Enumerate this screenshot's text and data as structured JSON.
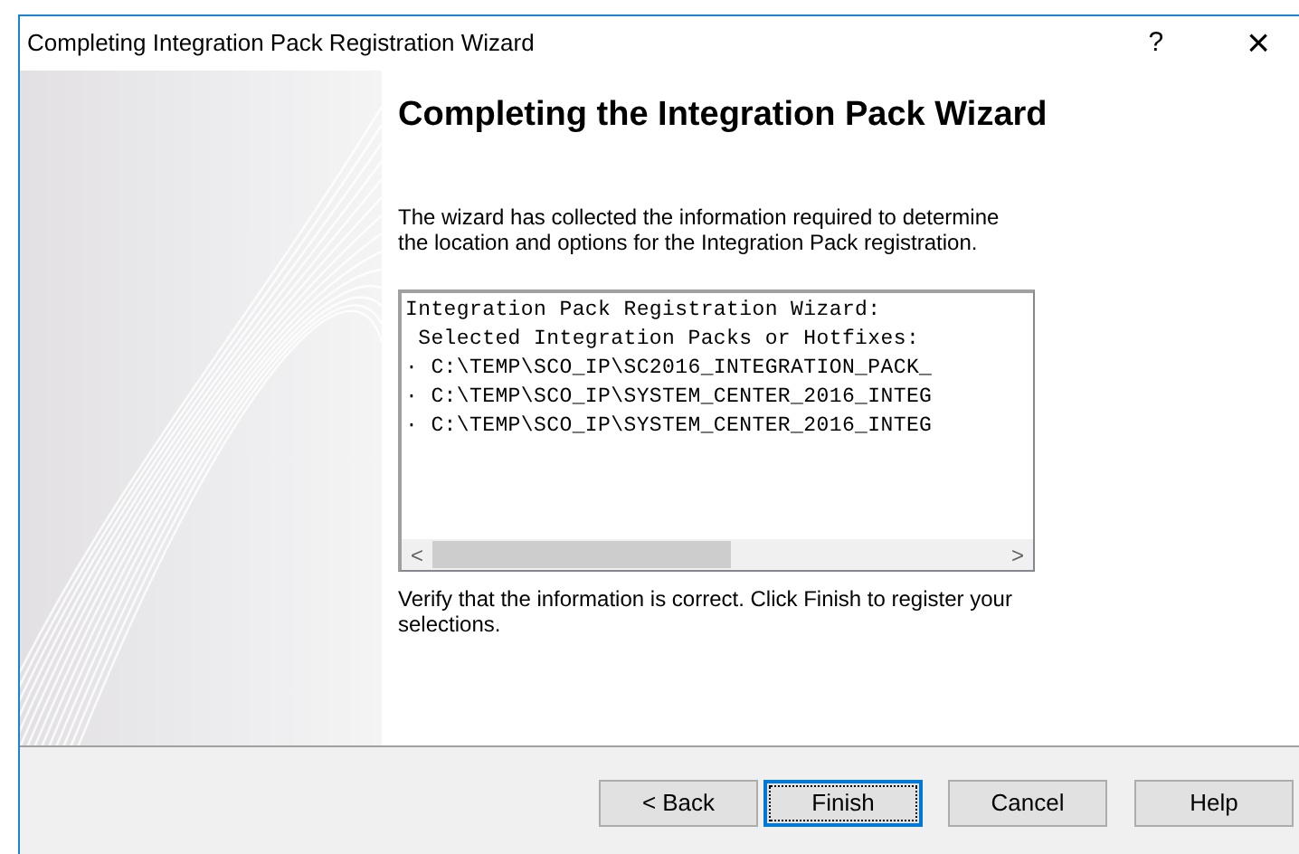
{
  "window": {
    "title": "Completing Integration Pack Registration Wizard",
    "help_glyph": "?",
    "close_glyph": "×"
  },
  "heading": "Completing the Integration Pack Wizard",
  "intro": "The wizard has collected the information required to determine the location and options for the Integration Pack registration.",
  "summary_lines": [
    "Integration Pack Registration Wizard:",
    " Selected Integration Packs or Hotfixes:",
    "· C:\\TEMP\\SCO_IP\\SC2016_INTEGRATION_PACK_",
    "· C:\\TEMP\\SCO_IP\\SYSTEM_CENTER_2016_INTEG",
    "· C:\\TEMP\\SCO_IP\\SYSTEM_CENTER_2016_INTEG"
  ],
  "scroll_left": "<",
  "scroll_right": ">",
  "outro": "Verify that the information is correct.  Click Finish to register your selections.",
  "buttons": [
    {
      "label": "< Back",
      "default": false
    },
    {
      "label": "Finish",
      "default": true
    },
    {
      "label": "Cancel",
      "default": false
    },
    {
      "label": "Help",
      "default": false
    }
  ]
}
